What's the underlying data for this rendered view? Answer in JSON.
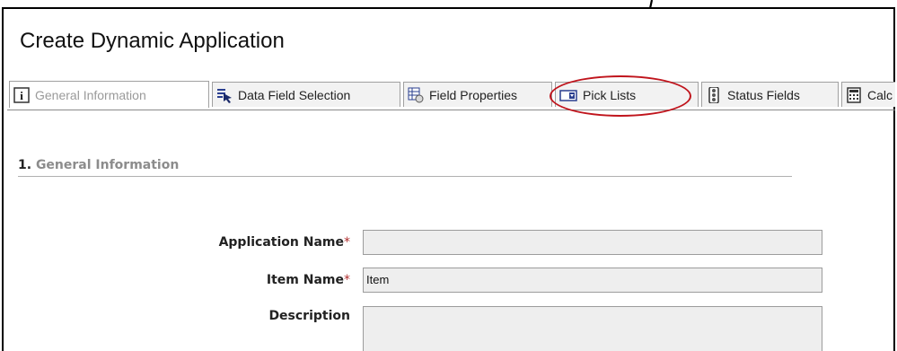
{
  "window": {
    "title": "Create Dynamic Application"
  },
  "tabs": [
    {
      "label": "General Information",
      "icon": "info-icon",
      "active": true
    },
    {
      "label": "Data Field Selection",
      "icon": "field-select-icon"
    },
    {
      "label": "Field Properties",
      "icon": "field-properties-icon"
    },
    {
      "label": "Pick Lists",
      "icon": "pick-list-icon"
    },
    {
      "label": "Status Fields",
      "icon": "traffic-light-icon"
    },
    {
      "label": "Calc",
      "icon": "calculator-icon"
    }
  ],
  "section": {
    "number": "1.",
    "title": "General Information"
  },
  "form": {
    "application_name": {
      "label": "Application Name",
      "required": "*",
      "value": ""
    },
    "item_name": {
      "label": "Item Name",
      "required": "*",
      "value": "Item"
    },
    "description": {
      "label": "Description",
      "value": ""
    }
  },
  "colors": {
    "callout": "#c0141c",
    "required": "#b03030",
    "active_tab_text": "#9a9a9a"
  }
}
